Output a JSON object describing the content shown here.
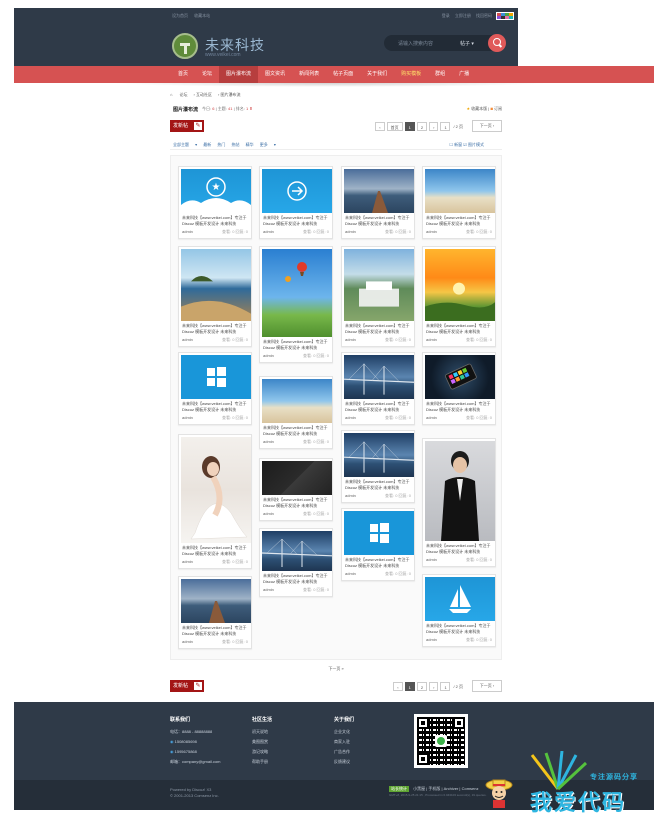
{
  "topbar": {
    "left_links": [
      "设为首页",
      "收藏本站"
    ],
    "right_links": [
      "登录",
      "立即注册",
      "找回密码"
    ]
  },
  "logo": {
    "title": "未来科技",
    "subtitle": "www.veikei.com"
  },
  "search": {
    "placeholder": "请输入搜索内容",
    "scope": "帖子"
  },
  "nav": {
    "items": [
      {
        "label": "首页",
        "state": "normal"
      },
      {
        "label": "论坛",
        "state": "normal"
      },
      {
        "label": "图片瀑布流",
        "state": "active"
      },
      {
        "label": "图文资讯",
        "state": "normal"
      },
      {
        "label": "新闻列表",
        "state": "normal"
      },
      {
        "label": "帖子页面",
        "state": "normal"
      },
      {
        "label": "关于我们",
        "state": "normal"
      },
      {
        "label": "购买模板",
        "state": "hot"
      },
      {
        "label": "群组",
        "state": "normal"
      },
      {
        "label": "广播",
        "state": "normal"
      }
    ]
  },
  "breadcrumb": [
    "论坛",
    "互动社区",
    "图片瀑布流"
  ],
  "board": {
    "title": "图片瀑布流",
    "today_label": "今日:",
    "today": "6",
    "topics_label": "主题:",
    "topics": "41",
    "rank_label": "排名:",
    "rank": "1",
    "favorite": "收藏本版",
    "rss": "订阅"
  },
  "toolbar": {
    "post_label": "发新帖",
    "pager_first": "首页",
    "pages": [
      "1",
      "2"
    ],
    "current_page": "1",
    "page_input": "1",
    "page_total": "/ 2 页",
    "next_label": "下一页"
  },
  "filter": {
    "items": [
      "全部主题",
      "最新",
      "热门",
      "热帖",
      "精华",
      "更多"
    ],
    "right_items": [
      "新窗",
      "图片模式"
    ]
  },
  "card_text": {
    "caption": "未来科技【www.veikei.com】专注于Discuz 模板开发设计 未来科技",
    "author": "admin",
    "stat": "查看: 0   回复: 0"
  },
  "cards": [
    {
      "img": "ph-blue",
      "icon": "star"
    },
    {
      "img": "ph-blue",
      "icon": "arrow"
    },
    {
      "img": "ph-pier",
      "icon": ""
    },
    {
      "img": "ph-beach",
      "icon": ""
    },
    {
      "img": "ph-island",
      "icon": ""
    },
    {
      "img": "ph-balloon",
      "icon": ""
    },
    {
      "img": "ph-wedding",
      "icon": ""
    },
    {
      "img": "ph-sunset",
      "icon": ""
    },
    {
      "img": "ph-win",
      "icon": "windows"
    },
    {
      "img": "ph-beach",
      "icon": ""
    },
    {
      "img": "ph-bridge",
      "icon": ""
    },
    {
      "img": "ph-phone",
      "icon": "phone"
    },
    {
      "img": "ph-girl",
      "icon": ""
    },
    {
      "img": "ph-dark",
      "icon": ""
    },
    {
      "img": "ph-bridge",
      "icon": ""
    },
    {
      "img": "ph-man",
      "icon": ""
    },
    {
      "img": "ph-pier",
      "icon": ""
    },
    {
      "img": "ph-bridge",
      "icon": ""
    },
    {
      "img": "ph-win",
      "icon": "windows"
    },
    {
      "img": "ph-blue",
      "icon": "boat"
    }
  ],
  "more_label": "下一页 »",
  "footer": {
    "col1": {
      "title": "联系我们",
      "lines": [
        "电话：8888 - 88888888",
        "1508085698",
        "1595675868",
        "邮箱：company@gmail.com"
      ]
    },
    "col2": {
      "title": "社区生活",
      "lines": [
        "初天说地",
        "美图图赏",
        "游记攻略",
        "帮助手册"
      ]
    },
    "col3": {
      "title": "关于我们",
      "lines": [
        "企业文化",
        "商家入驻",
        "广告合作",
        "反馈建议"
      ]
    },
    "powered": [
      "Powered by Discuz! X3",
      "© 2001-2013 Comsenz Inc."
    ],
    "links": "小黑屋 | 手机版 | Archiver | Comsenz",
    "badge": "站长统计",
    "timestamp": "GMT+8, 2015-9-25 21:15 , Processed in 0.043103 second(s), 19 queries."
  },
  "watermark": {
    "tag": "专注源码分享",
    "main": "我爱代码"
  },
  "colors": {
    "header": "#2f3a48",
    "nav": "#d65252",
    "accent": "#a31515",
    "link": "#3a6ea5"
  }
}
